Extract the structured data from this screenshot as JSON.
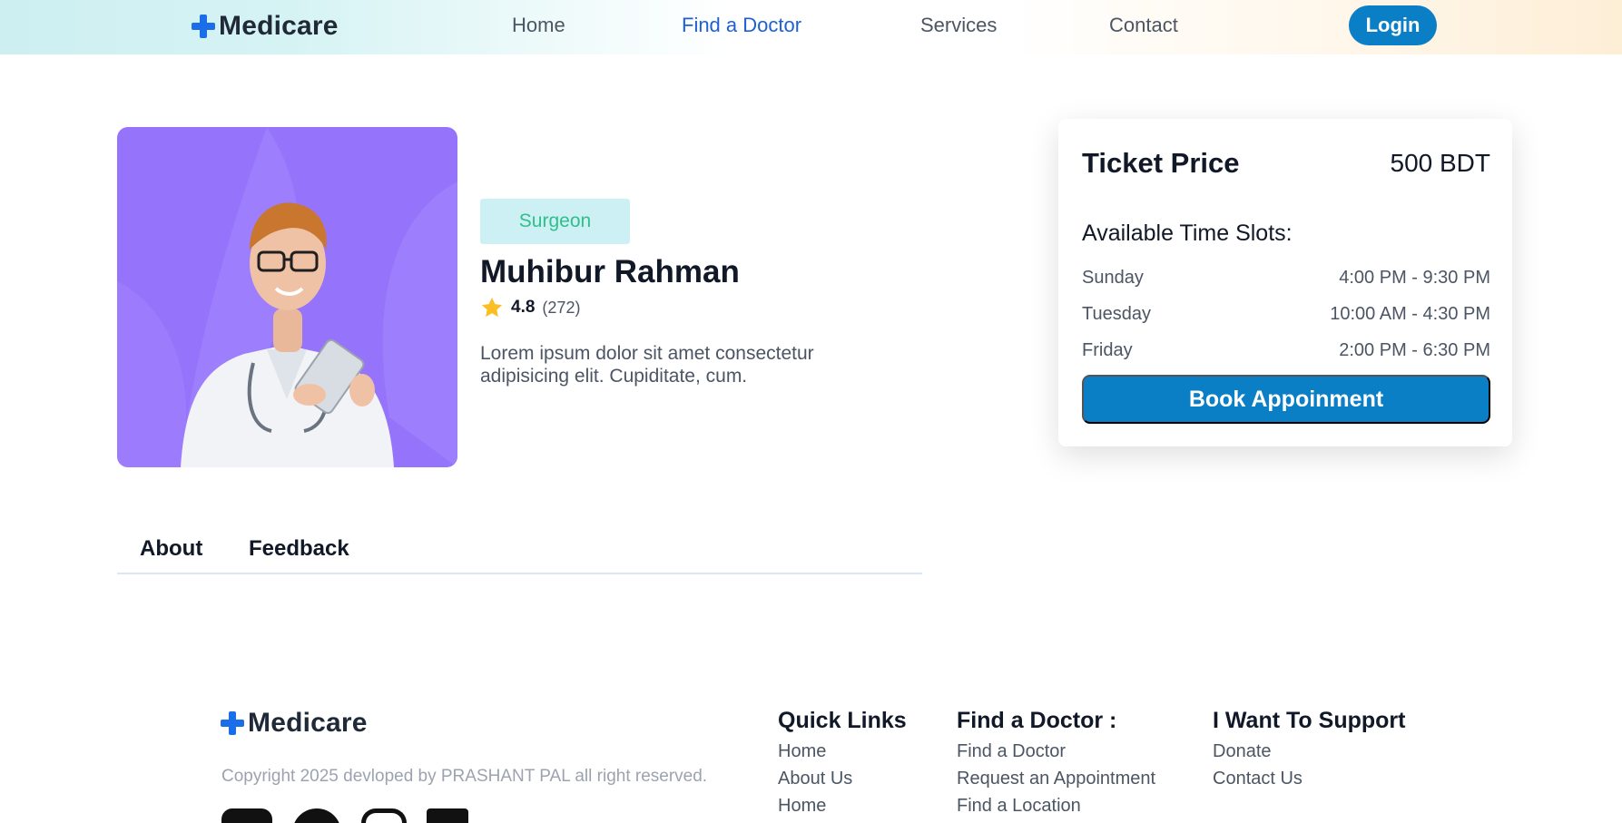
{
  "header": {
    "brand": "Medicare",
    "nav": [
      {
        "label": "Home",
        "active": false
      },
      {
        "label": "Find a Doctor",
        "active": true
      },
      {
        "label": "Services",
        "active": false
      },
      {
        "label": "Contact",
        "active": false
      }
    ],
    "login_label": "Login"
  },
  "doctor": {
    "specialty": "Surgeon",
    "name": "Muhibur Rahman",
    "rating": "4.8",
    "reviews": "(272)",
    "description": "Lorem ipsum dolor sit amet consectetur adipisicing elit. Cupiditate, cum."
  },
  "ticket": {
    "label": "Ticket Price",
    "price": "500 BDT",
    "slots_title": "Available Time Slots:",
    "slots": [
      {
        "day": "Sunday",
        "time": "4:00 PM - 9:30 PM"
      },
      {
        "day": "Tuesday",
        "time": "10:00 AM - 4:30 PM"
      },
      {
        "day": "Friday",
        "time": "2:00 PM - 6:30 PM"
      }
    ],
    "book_label": "Book Appoinment"
  },
  "tabs": [
    {
      "label": "About"
    },
    {
      "label": "Feedback"
    }
  ],
  "footer": {
    "brand": "Medicare",
    "copyright": "Copyright 2025 devloped by PRASHANT PAL all right reserved.",
    "columns": [
      {
        "title": "Quick Links",
        "links": [
          "Home",
          "About Us",
          "Home"
        ]
      },
      {
        "title": "Find a Doctor :",
        "links": [
          "Find a Doctor",
          "Request an Appointment",
          "Find a Location"
        ]
      },
      {
        "title": "I Want To Support",
        "links": [
          "Donate",
          "Contact Us"
        ]
      }
    ],
    "socials": [
      "youtube-icon",
      "github-icon",
      "instagram-icon",
      "linkedin-icon"
    ]
  },
  "colors": {
    "accent": "#0a7fc6",
    "brand_plus": "#1a6fe8",
    "active_nav": "#1e5fd6",
    "photo_bg": "#9673fb",
    "badge_bg": "#ccf0f3",
    "badge_text": "#2fbf8a",
    "star": "#fbbf24"
  }
}
